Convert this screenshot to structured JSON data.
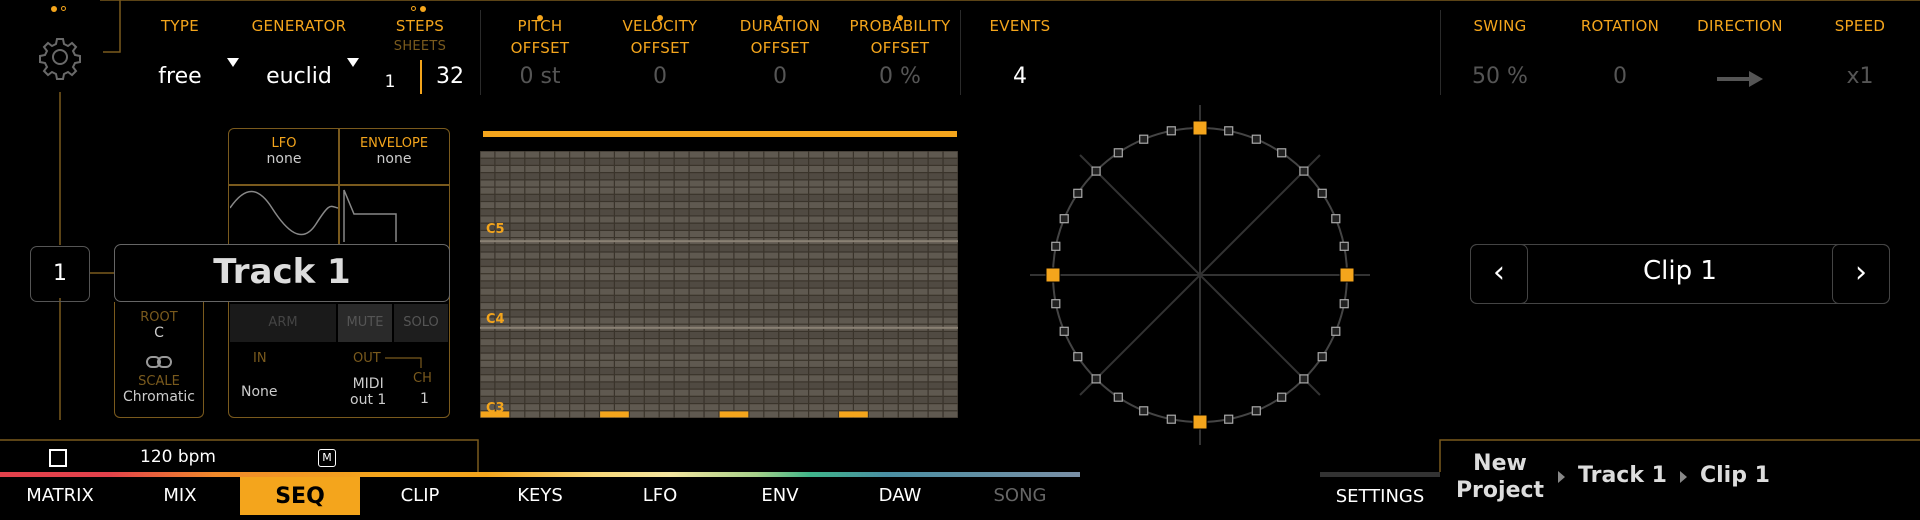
{
  "top": {
    "settings_icon": "gear-icon",
    "params": [
      {
        "key": "type",
        "label": "TYPE",
        "value": "free"
      },
      {
        "key": "generator",
        "label": "GENERATOR",
        "value": "euclid"
      },
      {
        "key": "steps",
        "label": "STEPS",
        "sub": "SHEETS",
        "sheets": "1",
        "value": "32"
      },
      {
        "key": "pitch",
        "label": "PITCH\nOFFSET",
        "value": "0 st"
      },
      {
        "key": "velocity",
        "label": "VELOCITY\nOFFSET",
        "value": "0"
      },
      {
        "key": "duration",
        "label": "DURATION\nOFFSET",
        "value": "0"
      },
      {
        "key": "probability",
        "label": "PROBABILITY\nOFFSET",
        "value": "0 %"
      },
      {
        "key": "events",
        "label": "EVENTS",
        "value": "4"
      },
      {
        "key": "swing",
        "label": "SWING",
        "value": "50 %"
      },
      {
        "key": "rotation",
        "label": "ROTATION",
        "value": "0"
      },
      {
        "key": "direction",
        "label": "DIRECTION",
        "value": "→"
      },
      {
        "key": "speed",
        "label": "SPEED",
        "value": "x1"
      }
    ]
  },
  "track": {
    "number": "1",
    "name": "Track 1",
    "lfo_label": "LFO",
    "lfo_value": "none",
    "env_label": "ENVELOPE",
    "env_value": "none",
    "root_label": "ROOT",
    "root_value": "C",
    "scale_label": "SCALE",
    "scale_value": "Chromatic",
    "arm": "ARM",
    "mute": "MUTE",
    "solo": "SOLO",
    "in_label": "IN",
    "in_value": "None",
    "out_label": "OUT",
    "out_value": "MIDI\nout 1",
    "ch_label": "CH",
    "ch_value": "1"
  },
  "piano_roll": {
    "labels": [
      "C5",
      "C4",
      "C3"
    ]
  },
  "clip": {
    "prev": "‹",
    "name": "Clip 1",
    "next": "›"
  },
  "transport": {
    "tempo": "120 bpm",
    "metronome": "M"
  },
  "tabs": [
    "MATRIX",
    "MIX",
    "SEQ",
    "CLIP",
    "KEYS",
    "LFO",
    "ENV",
    "DAW",
    "SONG"
  ],
  "active_tab": "SEQ",
  "settings_tab": "SETTINGS",
  "breadcrumb": {
    "project": "New\nProject",
    "track": "Track 1",
    "clip": "Clip 1"
  },
  "colors": {
    "accent": "#f4a51c"
  }
}
